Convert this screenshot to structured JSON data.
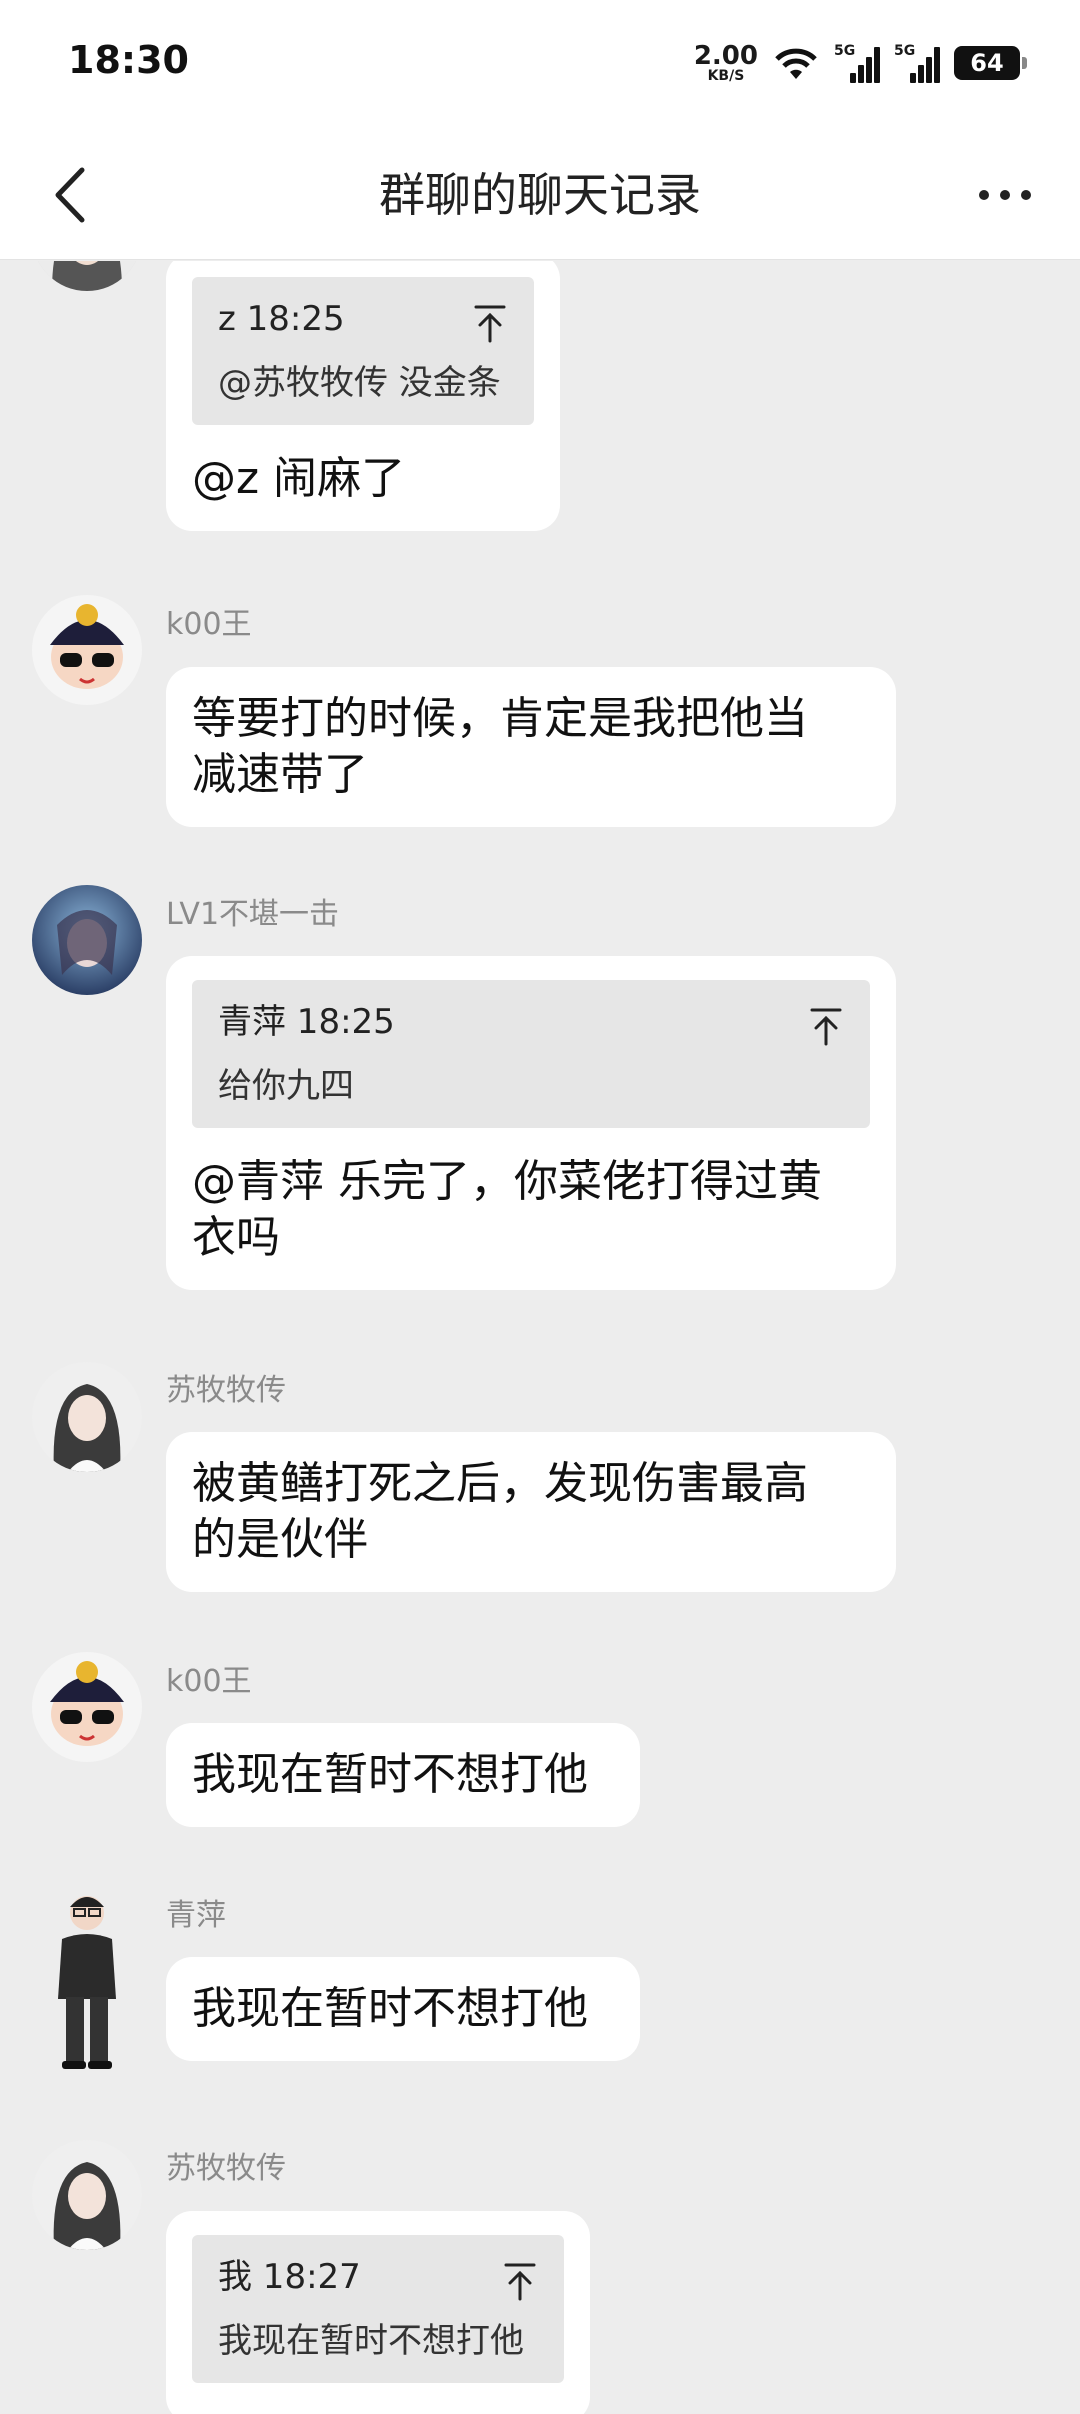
{
  "status": {
    "time": "18:30",
    "net_speed": "2.00",
    "net_unit": "KB/S",
    "sig1": "5G",
    "sig2": "5G",
    "battery": "64"
  },
  "header": {
    "title": "群聊的聊天记录"
  },
  "messages": {
    "m0": {
      "quote_head": "z 18:25",
      "quote_text": "@苏牧牧传 没金条",
      "text": "@z 闹麻了"
    },
    "m1": {
      "sender": "k00王",
      "text1": "等要打的时候，肯定是我把他当",
      "text2": "减速带了"
    },
    "m2": {
      "sender": "LV1不堪一击",
      "quote_head": "青萍 18:25",
      "quote_text": "给你九四",
      "text1": "@青萍 乐完了，你菜佬打得过黄",
      "text2": "衣吗"
    },
    "m3": {
      "sender": "苏牧牧传",
      "text1": "被黄鳝打死之后，发现伤害最高",
      "text2": "的是伙伴"
    },
    "m4": {
      "sender": "k00王",
      "text": "我现在暂时不想打他"
    },
    "m5": {
      "sender": "青萍",
      "text": "我现在暂时不想打他"
    },
    "m6": {
      "sender": "苏牧牧传",
      "quote_head": "我 18:27",
      "quote_text": "我现在暂时不想打他"
    }
  },
  "icons": {
    "back": "chevron-left-icon",
    "more": "more-dots-icon",
    "jump": "jump-to-original-icon"
  },
  "colors": {
    "background": "#ededed",
    "bubble": "#ffffff",
    "quote": "#e6e6e6",
    "sender": "#8a8a8a"
  }
}
